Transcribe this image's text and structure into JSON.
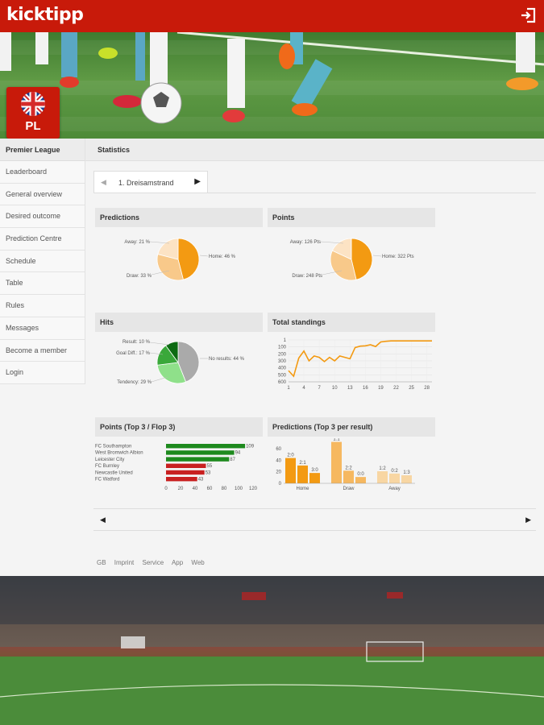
{
  "app": {
    "brand": "kicktipp",
    "league_code": "PL"
  },
  "sidebar": {
    "header": "Premier League",
    "items": [
      {
        "label": "Leaderboard"
      },
      {
        "label": "General overview"
      },
      {
        "label": "Desired outcome"
      },
      {
        "label": "Prediction Centre"
      },
      {
        "label": "Schedule"
      },
      {
        "label": "Table"
      },
      {
        "label": "Rules"
      },
      {
        "label": "Messages"
      },
      {
        "label": "Become a member"
      },
      {
        "label": "Login"
      }
    ]
  },
  "main": {
    "title": "Statistics",
    "tab": {
      "label": "1. Dreisamstrand"
    }
  },
  "panels": {
    "predictions": {
      "title": "Predictions",
      "labels": [
        "Away: 21 %",
        "Home: 46 %",
        "Draw: 33 %"
      ]
    },
    "points": {
      "title": "Points",
      "labels": [
        "Away: 126 Pts",
        "Home: 322 Pts",
        "Draw: 248 Pts"
      ]
    },
    "hits": {
      "title": "Hits",
      "labels": [
        "Result: 10 %",
        "Goal Diff.: 17 %",
        "No results: 44 %",
        "Tendency: 29 %"
      ]
    },
    "total_standings": {
      "title": "Total standings",
      "yticks": [
        "1",
        "100",
        "200",
        "300",
        "400",
        "500",
        "600"
      ],
      "xticks": [
        "1",
        "4",
        "7",
        "10",
        "13",
        "16",
        "19",
        "22",
        "25",
        "28"
      ]
    },
    "points_top_flop": {
      "title": "Points (Top 3 / Flop 3)",
      "teams": [
        "FC Southampton",
        "West Bromwich Albion",
        "Leicester City",
        "FC Burnley",
        "Newcastle United",
        "FC Watford"
      ],
      "values": [
        "109",
        "94",
        "87",
        "55",
        "53",
        "43"
      ],
      "xticks": [
        "0",
        "20",
        "40",
        "60",
        "80",
        "100",
        "120"
      ]
    },
    "predictions_top3": {
      "title": "Predictions (Top 3 per result)",
      "yticks": [
        "0",
        "20",
        "40",
        "60"
      ],
      "groups": [
        "Home",
        "Draw",
        "Away"
      ],
      "bar_labels": [
        "2:0",
        "2:1",
        "3:0",
        "1:1",
        "2:2",
        "0:0",
        "1:2",
        "0:2",
        "1:3"
      ]
    }
  },
  "footer": {
    "links": [
      "GB",
      "Imprint",
      "Service",
      "App",
      "Web"
    ]
  },
  "chart_data": [
    {
      "type": "pie",
      "title": "Predictions",
      "categories": [
        "Home",
        "Draw",
        "Away"
      ],
      "values": [
        46,
        33,
        21
      ],
      "colors": [
        "#f39a12",
        "#f8c98a",
        "#fce3c4"
      ]
    },
    {
      "type": "pie",
      "title": "Points",
      "categories": [
        "Home",
        "Draw",
        "Away"
      ],
      "values": [
        322,
        248,
        126
      ],
      "colors": [
        "#f39a12",
        "#f8c98a",
        "#fce3c4"
      ]
    },
    {
      "type": "pie",
      "title": "Hits",
      "categories": [
        "No results",
        "Tendency",
        "Goal Diff.",
        "Result"
      ],
      "values": [
        44,
        29,
        17,
        10
      ],
      "colors": [
        "#aaaaaa",
        "#8fe08a",
        "#3aa83a",
        "#0d6b12"
      ]
    },
    {
      "type": "line",
      "title": "Total standings",
      "x": [
        1,
        2,
        3,
        4,
        5,
        6,
        7,
        8,
        9,
        10,
        11,
        12,
        13,
        14,
        15,
        16,
        17,
        18,
        19,
        20,
        21,
        22,
        23,
        24,
        25,
        26,
        27,
        28,
        29
      ],
      "values": [
        440,
        520,
        260,
        160,
        300,
        230,
        250,
        310,
        250,
        300,
        230,
        250,
        270,
        110,
        90,
        85,
        70,
        95,
        30,
        20,
        15,
        15,
        15,
        15,
        15,
        15,
        15,
        15,
        15
      ],
      "ylim": [
        600,
        1
      ],
      "color": "#f39a12"
    },
    {
      "type": "bar",
      "title": "Points (Top 3 / Flop 3)",
      "categories": [
        "FC Southampton",
        "West Bromwich Albion",
        "Leicester City",
        "FC Burnley",
        "Newcastle United",
        "FC Watford"
      ],
      "values": [
        109,
        94,
        87,
        55,
        53,
        43
      ],
      "xlim": [
        0,
        120
      ],
      "colors": [
        "#1e8a1e",
        "#1e8a1e",
        "#1e8a1e",
        "#c82020",
        "#c82020",
        "#c82020"
      ]
    },
    {
      "type": "bar",
      "title": "Predictions (Top 3 per result)",
      "groups": [
        "Home",
        "Draw",
        "Away"
      ],
      "categories": [
        "2:0",
        "2:1",
        "3:0",
        "1:1",
        "2:2",
        "0:0",
        "1:2",
        "0:2",
        "1:3"
      ],
      "values": [
        44,
        31,
        18,
        72,
        22,
        11,
        21,
        17,
        14
      ],
      "ylim": [
        0,
        70
      ],
      "colors": [
        "#f39a12",
        "#f39a12",
        "#f39a12",
        "#f6b860",
        "#f6b860",
        "#f6b860",
        "#f8d6a3",
        "#f8d6a3",
        "#f8d6a3"
      ]
    }
  ]
}
